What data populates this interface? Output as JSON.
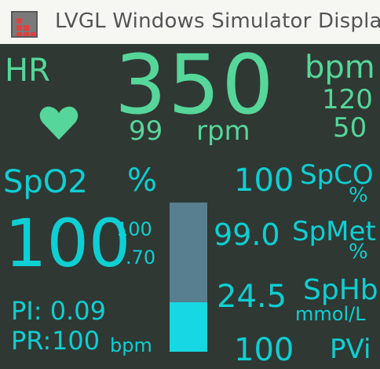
{
  "window": {
    "title": "LVGL Windows Simulator Display",
    "icon": "lvgl-app-icon"
  },
  "hr": {
    "label": "HR",
    "value": "350",
    "unit": "bpm",
    "limit_high": "120",
    "limit_low": "50",
    "rpm_value": "99",
    "rpm_unit": "rpm",
    "icon": "heart-icon"
  },
  "spo2": {
    "label": "SpO2",
    "unit": "%",
    "value": "100",
    "limit_high": "100",
    "limit_low": ".70",
    "pi": "PI: 0.09",
    "pr_label": "PR:",
    "pr_value": "100",
    "pr_unit": "bpm",
    "signal_level": 0.33
  },
  "spco": {
    "value": "100",
    "label": "SpCO",
    "unit": "%"
  },
  "spmet": {
    "value": "99.0",
    "label": "SpMet",
    "unit": "%"
  },
  "sphb": {
    "value": "24.5",
    "label": "SpHb",
    "unit": "mmol/L"
  },
  "pvi": {
    "value": "100",
    "label": "PVi"
  },
  "colors": {
    "heart_rate": "#56d69a",
    "spo2": "#0ecfd3",
    "bar_track": "#577f8f",
    "bar_fill": "#17d7e2"
  }
}
